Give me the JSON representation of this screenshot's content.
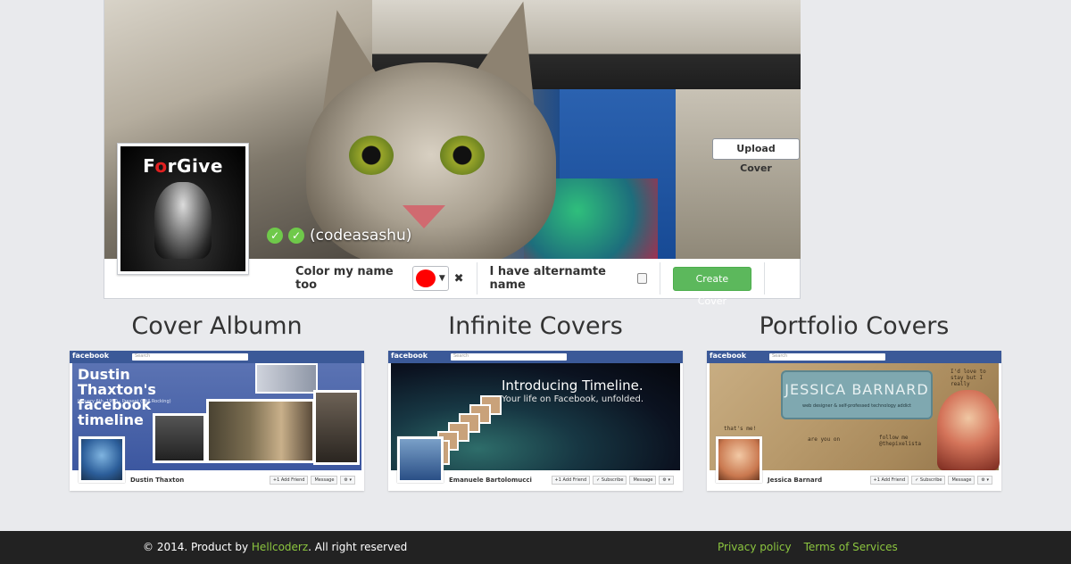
{
  "cover": {
    "upload_label": "Upload Cover",
    "avatar_text_pre": "F",
    "avatar_text_red": "o",
    "avatar_text_post": "rGive",
    "username": "(codeasashu)",
    "color_label": "Color my name too",
    "color_value": "#ff0000",
    "clear_icon": "close-icon",
    "alt_name_label": "I have alternamte name",
    "create_label": "Create Cover"
  },
  "gallery": [
    {
      "title": "Cover Albumn",
      "fb_logo": "facebook",
      "search_placeholder": "Search",
      "headline": "Dustin Thaxton's facebook timeline",
      "subline": "January 6th, 1990 - Present (Still Rocking)",
      "profile_name": "Dustin Thaxton",
      "buttons": [
        "+1 Add Friend",
        "Message",
        "⚙ ▾"
      ]
    },
    {
      "title": "Infinite Covers",
      "fb_logo": "facebook",
      "search_placeholder": "Search",
      "headline": "Introducing Timeline.",
      "subline": "Your life on Facebook, unfolded.",
      "profile_name": "Emanuele Bartolomucci",
      "buttons": [
        "+1 Add Friend",
        "✓ Subscribe",
        "Message",
        "⚙ ▾"
      ]
    },
    {
      "title": "Portfolio Covers",
      "fb_logo": "facebook",
      "search_placeholder": "Search",
      "headline": "JESSICA BARNARD",
      "subline": "web designer & self-professed technology addict",
      "notes": [
        "that's me!",
        "are you on",
        "follow me @thepixelista",
        "I'd love to stay but I really"
      ],
      "profile_name": "Jessica Barnard",
      "buttons": [
        "+1 Add Friend",
        "✓ Subscribe",
        "Message",
        "⚙ ▾"
      ]
    }
  ],
  "footer": {
    "copy_pre": "© 2014. Product by ",
    "brand": "Hellcoderz",
    "copy_post": ". All right reserved",
    "privacy": "Privacy policy",
    "terms": "Terms of Services"
  }
}
